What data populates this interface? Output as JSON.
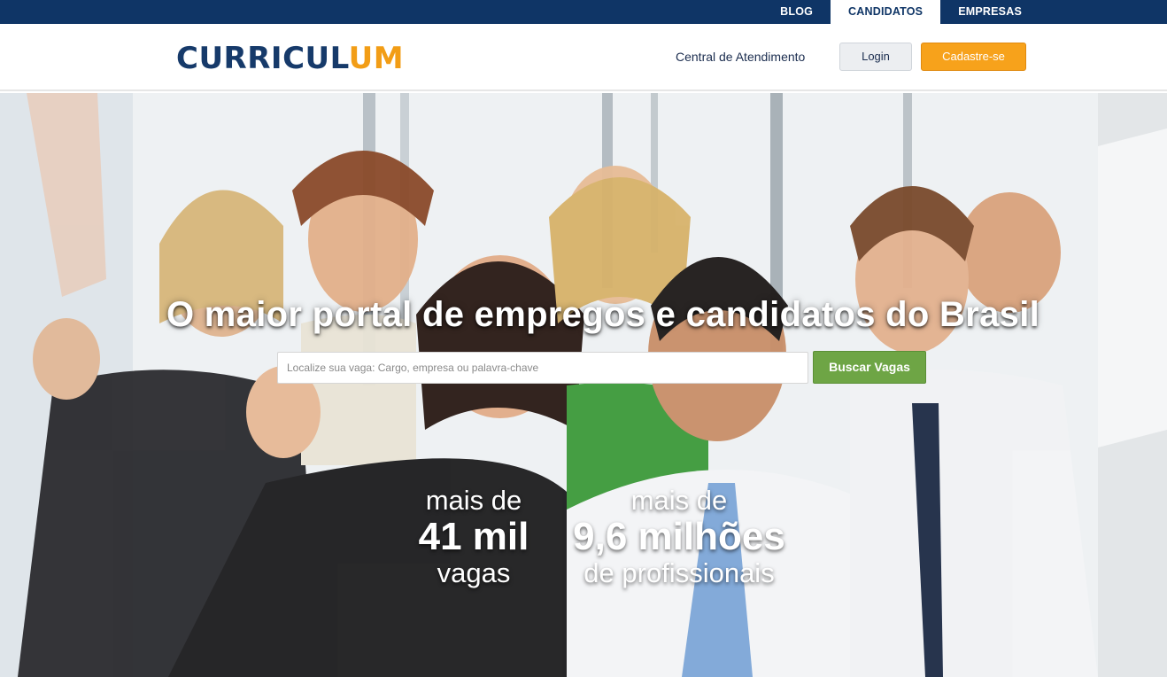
{
  "topnav": {
    "items": [
      {
        "label": "BLOG",
        "active": false
      },
      {
        "label": "CANDIDATOS",
        "active": true
      },
      {
        "label": "EMPRESAS",
        "active": false
      }
    ]
  },
  "header": {
    "logo_main": "CURRICUL",
    "logo_accent": "UM",
    "help_link": "Central de Atendimento",
    "login_label": "Login",
    "signup_label": "Cadastre-se"
  },
  "hero": {
    "headline": "O maior portal de empregos e candidatos do Brasil",
    "search": {
      "placeholder": "Localize sua vaga: Cargo, empresa ou palavra-chave",
      "button_label": "Buscar Vagas"
    },
    "stats": [
      {
        "prefix": "mais de",
        "value": "41 mil",
        "suffix": "vagas"
      },
      {
        "prefix": "mais de",
        "value": "9,6 milhões",
        "suffix": "de profissionais"
      }
    ]
  },
  "colors": {
    "topbar": "#0f3566",
    "logo_blue": "#163a6a",
    "logo_orange": "#f29d16",
    "signup": "#f7a21b",
    "search_button": "#6ea545"
  }
}
